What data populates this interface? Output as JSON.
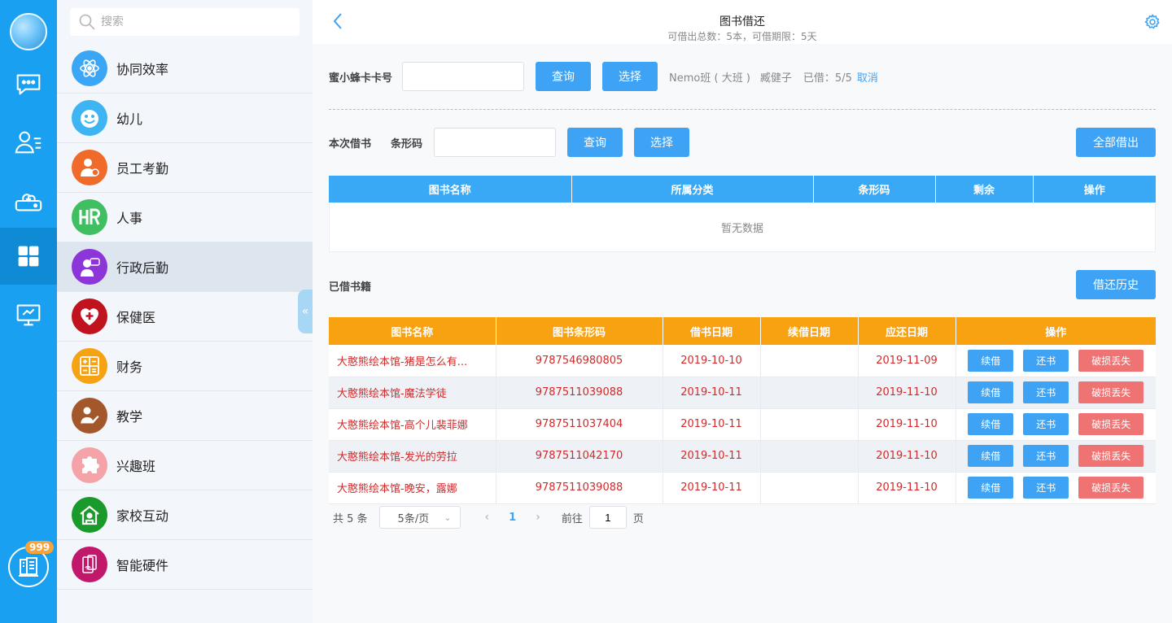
{
  "rail": {
    "items": [
      {
        "icon": "chat-icon"
      },
      {
        "icon": "contacts-icon"
      },
      {
        "icon": "cloud-drive-icon"
      },
      {
        "icon": "apps-grid-icon"
      },
      {
        "icon": "monitor-icon"
      }
    ],
    "badge": "999"
  },
  "search": {
    "placeholder": "搜索"
  },
  "modules": [
    {
      "label": "协同效率",
      "color": "#3aa6f5"
    },
    {
      "label": "幼儿",
      "color": "#3fb4f2"
    },
    {
      "label": "员工考勤",
      "color": "#f06a2a"
    },
    {
      "label": "人事",
      "color": "#3fbf62"
    },
    {
      "label": "行政后勤",
      "color": "#8c35d8"
    },
    {
      "label": "保健医",
      "color": "#c0131e"
    },
    {
      "label": "财务",
      "color": "#f7a212"
    },
    {
      "label": "教学",
      "color": "#a4572a"
    },
    {
      "label": "兴趣班",
      "color": "#f4a3a8"
    },
    {
      "label": "家校互动",
      "color": "#1a9a2a"
    },
    {
      "label": "智能硬件",
      "color": "#c2186b"
    }
  ],
  "header": {
    "title": "图书借还",
    "subtitle": "可借出总数：5本，可借期限：5天"
  },
  "card": {
    "label": "蜜小蜂卡卡号",
    "value": "",
    "query_label": "查询",
    "select_label": "选择",
    "class_name": "Nemo班 ( 大班 )",
    "student": "臧健子",
    "borrowed": "已借：5/5",
    "cancel_label": "取消"
  },
  "borrow": {
    "section_label": "本次借书",
    "barcode_label": "条形码",
    "barcode_value": "",
    "query_label": "查询",
    "select_label": "选择",
    "all_label": "全部借出",
    "columns": [
      "图书名称",
      "所属分类",
      "条形码",
      "剩余",
      "操作"
    ],
    "empty_text": "暂无数据"
  },
  "borrowed_books": {
    "section_label": "已借书籍",
    "history_label": "借还历史",
    "columns": [
      "图书名称",
      "图书条形码",
      "借书日期",
      "续借日期",
      "应还日期",
      "操作"
    ],
    "actions": {
      "renew": "续借",
      "return": "还书",
      "lost": "破损丢失"
    },
    "rows": [
      {
        "name": "大憨熊绘本馆-猪是怎么有...",
        "barcode": "9787546980805",
        "borrow_date": "2019-10-10",
        "renew_date": "",
        "due_date": "2019-11-09"
      },
      {
        "name": "大憨熊绘本馆-魔法学徒",
        "barcode": "9787511039088",
        "borrow_date": "2019-10-11",
        "renew_date": "",
        "due_date": "2019-11-10"
      },
      {
        "name": "大憨熊绘本馆-高个儿裴菲娜",
        "barcode": "9787511037404",
        "borrow_date": "2019-10-11",
        "renew_date": "",
        "due_date": "2019-11-10"
      },
      {
        "name": "大憨熊绘本馆-发光的劳拉",
        "barcode": "9787511042170",
        "borrow_date": "2019-10-11",
        "renew_date": "",
        "due_date": "2019-11-10"
      },
      {
        "name": "大憨熊绘本馆-晚安，露娜",
        "barcode": "9787511039088",
        "borrow_date": "2019-10-11",
        "renew_date": "",
        "due_date": "2019-11-10"
      }
    ]
  },
  "pagination": {
    "total": "共 5 条",
    "page_size": "5条/页",
    "current": "1",
    "goto_label": "前往",
    "goto_value": "1",
    "page_suffix": "页"
  }
}
